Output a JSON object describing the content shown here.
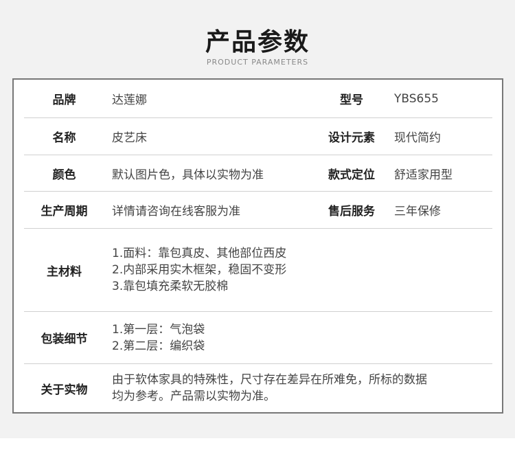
{
  "header": {
    "title": "产品参数",
    "subtitle": "PRODUCT PARAMETERS"
  },
  "rows": [
    {
      "label": "品牌",
      "value": "达莲娜",
      "label2": "型号",
      "value2": "YBS655"
    },
    {
      "label": "名称",
      "value": "皮艺床",
      "label2": "设计元素",
      "value2": "现代简约"
    },
    {
      "label": "颜色",
      "value": "默认图片色，具体以实物为准",
      "label2": "款式定位",
      "value2": "舒适家用型"
    },
    {
      "label": "生产周期",
      "value": "详情请咨询在线客服为准",
      "label2": "售后服务",
      "value2": "三年保修"
    }
  ],
  "material": {
    "label": "主材料",
    "lines": [
      "1.面料：靠包真皮、其他部位西皮",
      "2.内部采用实木框架，稳固不变形",
      "3.靠包填充柔软无胶棉"
    ]
  },
  "packaging": {
    "label": "包装细节",
    "lines": [
      "1.第一层：气泡袋",
      "2.第二层：编织袋"
    ]
  },
  "notice": {
    "label": "关于实物",
    "lines": [
      "由于软体家具的特殊性，尺寸存在差异在所难免，所标的数据",
      "均为参考。产品需以实物为准。"
    ]
  }
}
